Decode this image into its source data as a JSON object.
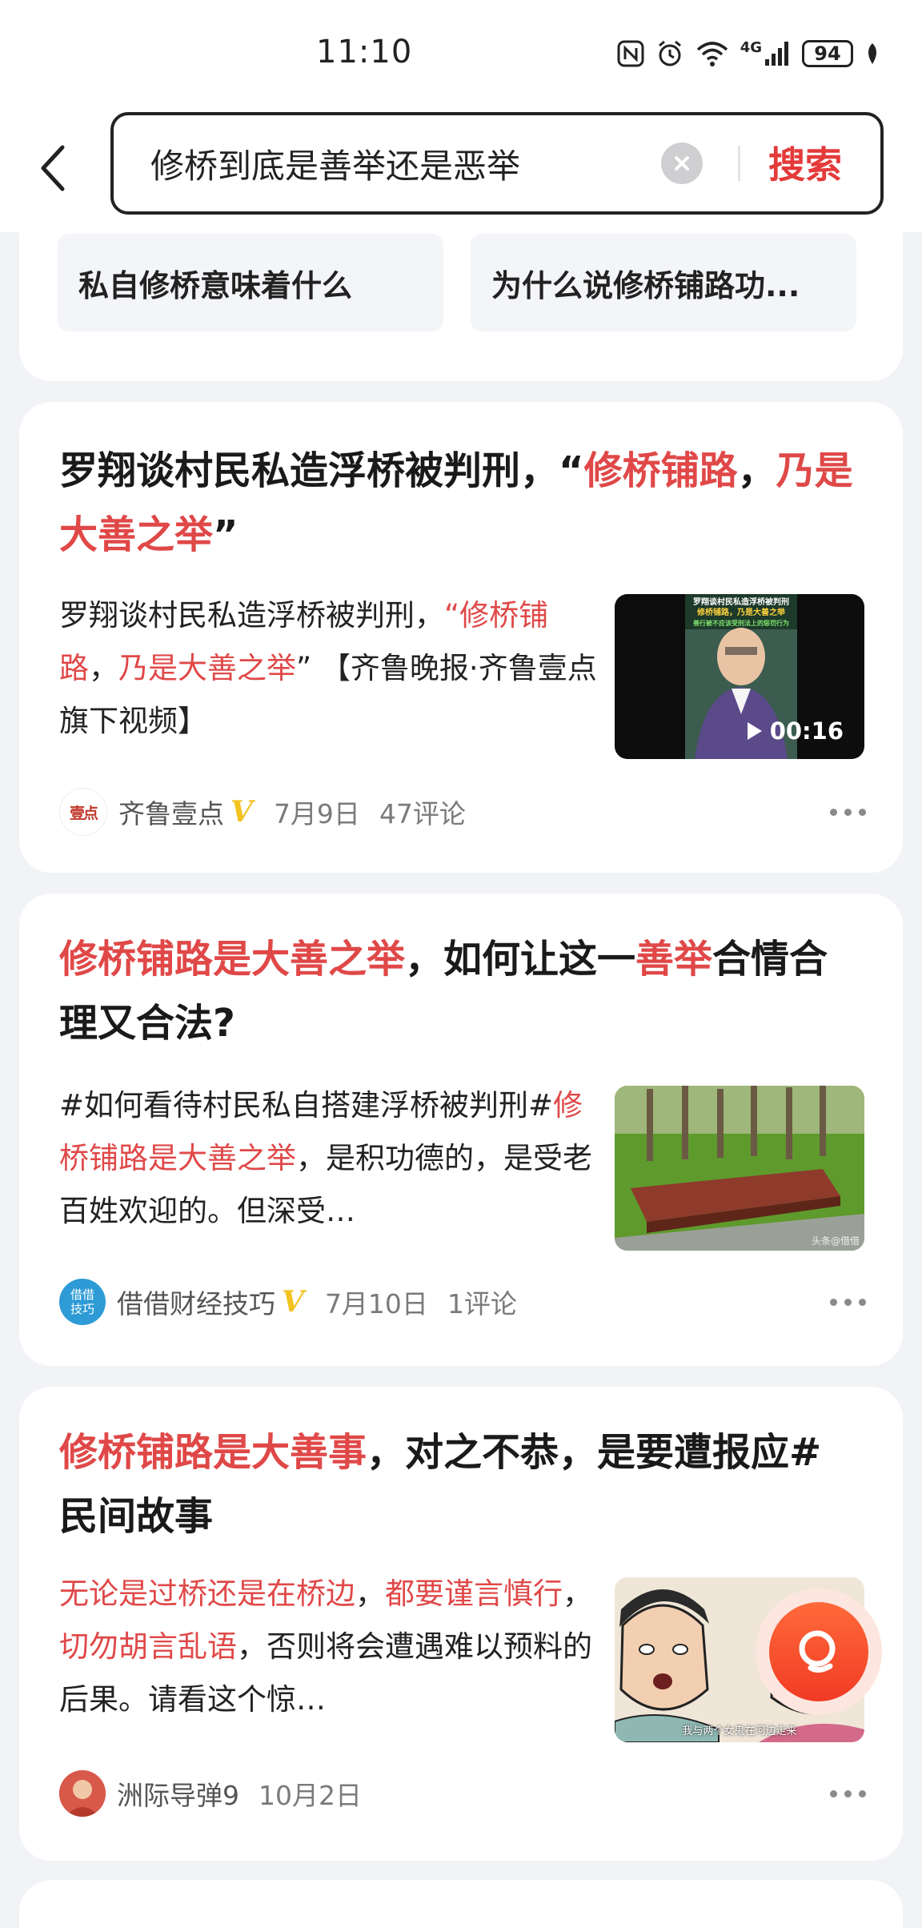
{
  "status_bar": {
    "time": "11:10",
    "network": "4G",
    "battery": "94"
  },
  "search": {
    "query": "修桥到底是善举还是恶举",
    "button_label": "搜索"
  },
  "related": [
    "私自修桥意味着什么",
    "为什么说修桥铺路功..."
  ],
  "results": [
    {
      "title_parts": [
        "罗翔谈村民私造浮桥被判刑，",
        "“",
        "修桥铺路",
        "，",
        "乃是大善之举",
        "”"
      ],
      "snippet_parts": [
        "罗翔谈村民私造浮桥被判刑，",
        "“修桥铺路",
        "，",
        "乃是大善之举",
        "” 【齐鲁晚报·齐鲁壹点旗下视频】"
      ],
      "video": {
        "duration": "00:16",
        "overlay_text": [
          "罗翔谈村民私造浮桥被判刑",
          "修桥铺路，乃是大善之举",
          "善行被不应该受刑法上的惩罚行为"
        ]
      },
      "source": "齐鲁壹点",
      "avatar_text": "壹点",
      "verified": "V",
      "date": "7月9日",
      "comments": "47评论"
    },
    {
      "title_parts": [
        "修桥铺路是大善之举",
        "，如何让这一",
        "善举",
        "合情合理又合法?"
      ],
      "snippet_parts": [
        "#如何看待村民私自搭建浮桥被判刑#",
        "修桥铺路是大善之举",
        "，是积功德的，是受老百姓欢迎的。但深受…"
      ],
      "image_watermark": "头条@借借",
      "source": "借借财经技巧",
      "avatar_text": "借借技巧",
      "verified": "V",
      "date": "7月10日",
      "comments": "1评论"
    },
    {
      "title_parts": [
        "修桥铺路是大善事",
        "，对之不恭，是要遭报应#民间故事"
      ],
      "snippet_parts": [
        "无论是过桥还是在桥边",
        "，",
        "都要谨言慎行",
        "，",
        "切勿胡言乱语",
        "，否则将会遭遇难以预料的后果。请看这个惊…"
      ],
      "image_caption": "我与两个女鬼在河边走来",
      "source": "洲际导弹9",
      "date": "10月2日"
    }
  ],
  "colors": {
    "accent": "#e43a3a",
    "highlight": "#e04848",
    "verified": "#f2c31f",
    "background": "#f2f3f6"
  },
  "icons": [
    "back-arrow-icon",
    "clear-icon",
    "play-icon",
    "more-icon",
    "search-icon",
    "nfc-icon",
    "alarm-icon",
    "wifi-icon",
    "signal-icon",
    "battery-icon",
    "leaf-icon"
  ]
}
